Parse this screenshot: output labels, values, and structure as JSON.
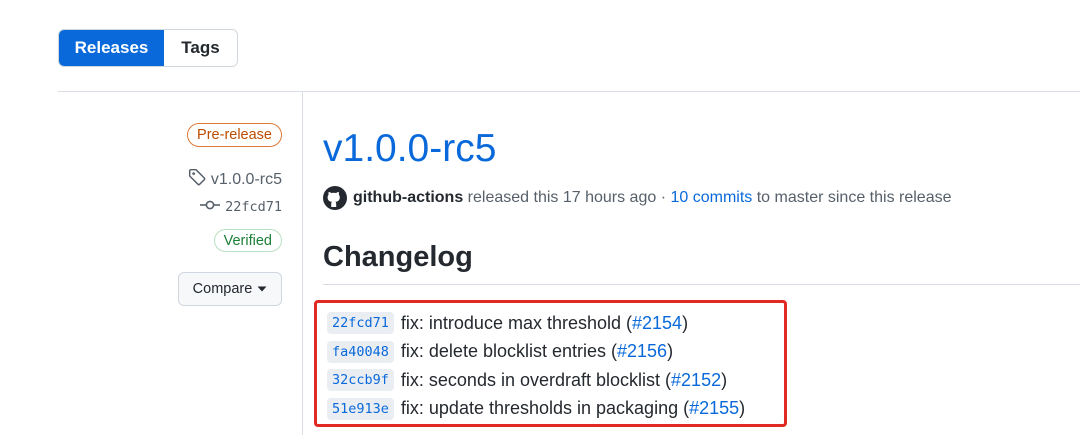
{
  "tabs": [
    {
      "label": "Releases",
      "active": true
    },
    {
      "label": "Tags",
      "active": false
    }
  ],
  "sidebar": {
    "prerelease_badge": "Pre-release",
    "tag_name": "v1.0.0-rc5",
    "commit_sha": "22fcd71",
    "verified_badge": "Verified",
    "compare_button": "Compare"
  },
  "release": {
    "title": "v1.0.0-rc5",
    "author": "github-actions",
    "released_text": "released this 17 hours ago",
    "separator": "·",
    "commits_link": "10 commits",
    "commits_suffix": "to master since this release"
  },
  "changelog": {
    "heading": "Changelog",
    "entries": [
      {
        "sha": "22fcd71",
        "message": "fix: introduce max threshold",
        "pr": "#2154"
      },
      {
        "sha": "fa40048",
        "message": "fix: delete blocklist entries",
        "pr": "#2156"
      },
      {
        "sha": "32ccb9f",
        "message": "fix: seconds in overdraft blocklist",
        "pr": "#2152"
      },
      {
        "sha": "51e913e",
        "message": "fix: update thresholds in packaging",
        "pr": "#2155"
      }
    ]
  },
  "colors": {
    "accent": "#0969da",
    "prerelease": "#bc4c00",
    "verified": "#1a7f37",
    "highlight": "#e02a23"
  },
  "icons": {
    "tag": "tag-icon",
    "commit": "git-commit-icon",
    "dropdown": "triangle-down-icon",
    "avatar": "github-mark-icon"
  }
}
